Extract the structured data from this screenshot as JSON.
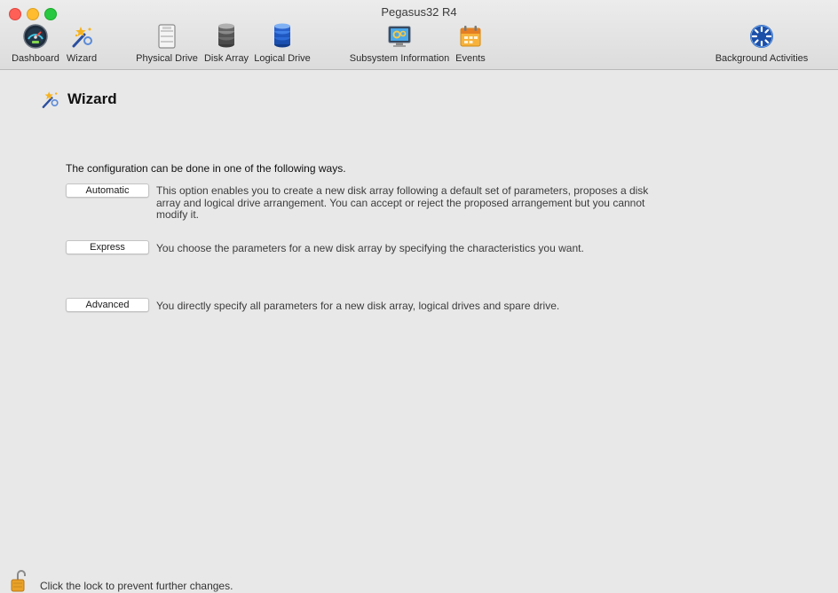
{
  "window": {
    "title": "Pegasus32 R4"
  },
  "toolbar": {
    "dashboard": {
      "label": "Dashboard",
      "icon": "speedometer-icon"
    },
    "wizard": {
      "label": "Wizard",
      "icon": "wizard-wand-icon"
    },
    "physical_drive": {
      "label": "Physical Drive",
      "icon": "physical-drive-icon"
    },
    "disk_array": {
      "label": "Disk Array",
      "icon": "disk-array-icon"
    },
    "logical_drive": {
      "label": "Logical Drive",
      "icon": "logical-drive-icon"
    },
    "subsystem_information": {
      "label": "Subsystem Information",
      "icon": "subsystem-monitor-icon"
    },
    "events": {
      "label": "Events",
      "icon": "calendar-icon"
    },
    "background_activities": {
      "label": "Background Activities",
      "icon": "spinner-globe-icon"
    }
  },
  "page": {
    "title": "Wizard",
    "intro": "The configuration can be done in one of the following ways.",
    "options": [
      {
        "label": "Automatic",
        "description": "This option enables you to create a new disk array following a default set of parameters, proposes a disk array and logical drive arrangement. You can accept or reject the proposed arrangement but you cannot modify it."
      },
      {
        "label": "Express",
        "description": "You choose the parameters for a new disk array by specifying the characteristics you want."
      },
      {
        "label": "Advanced",
        "description": "You directly specify all parameters for a new disk array, logical drives and spare drive."
      }
    ]
  },
  "status": {
    "lock_text": "Click the lock to prevent further changes."
  },
  "colors": {
    "close": "#fe5f57",
    "minimize": "#febc2e",
    "maximize": "#28c840",
    "background": "#e8e8e8"
  }
}
